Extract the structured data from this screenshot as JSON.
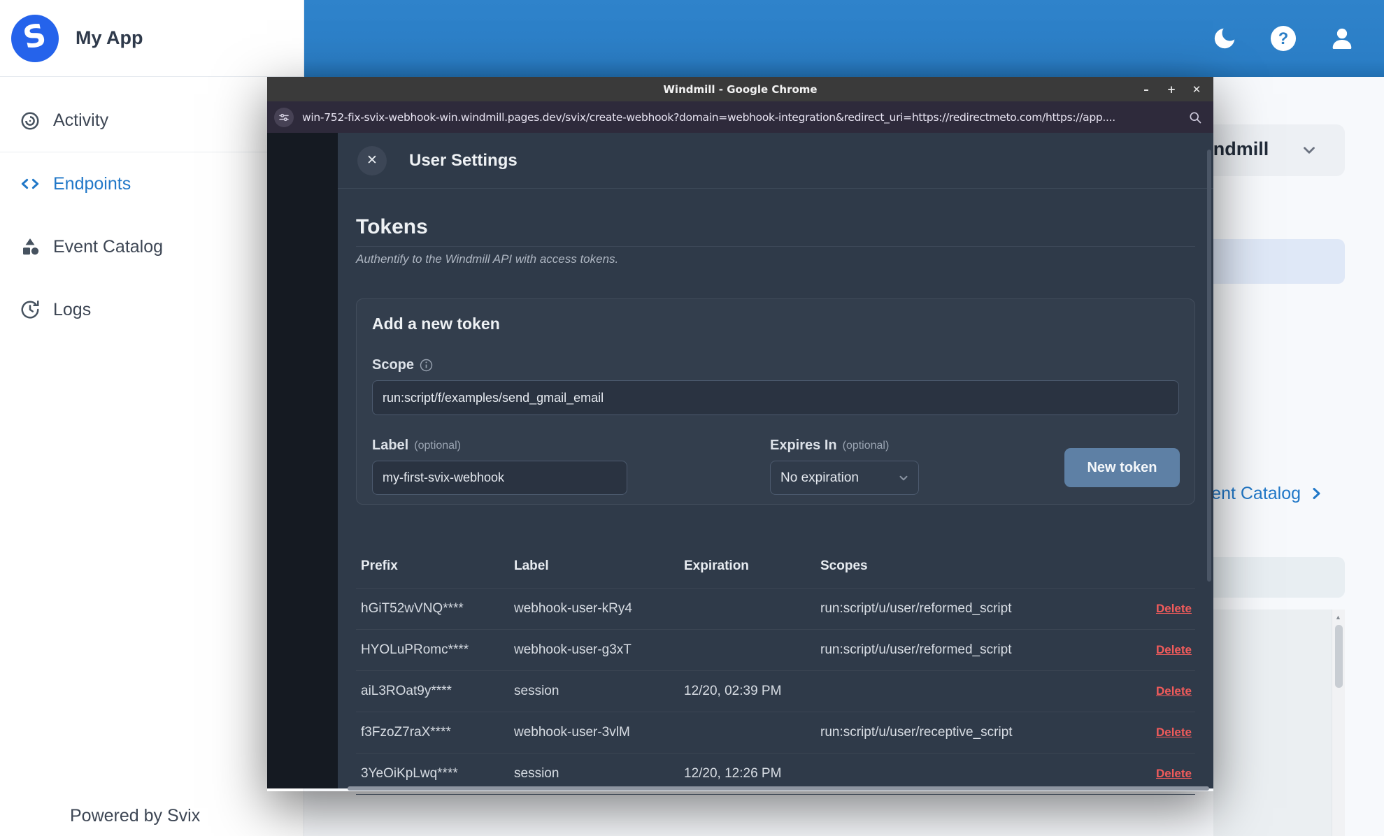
{
  "sidebar": {
    "app_name": "My App",
    "items": [
      {
        "label": "Activity"
      },
      {
        "label": "Endpoints"
      },
      {
        "label": "Event Catalog"
      },
      {
        "label": "Logs"
      }
    ],
    "footer": "Powered by Svix"
  },
  "background": {
    "workspace_selector_label": "Windmill",
    "event_catalog_link": "Event Catalog"
  },
  "window": {
    "title": "Windmill - Google Chrome",
    "controls": {
      "minimize": "–",
      "maximize": "+",
      "close": "✕"
    },
    "url": "win-752-fix-svix-webhook-win.windmill.pages.dev/svix/create-webhook?domain=webhook-integration&redirect_uri=https://redirectmeto.com/https://app....",
    "modal": {
      "title": "User Settings",
      "close_glyph": "✕",
      "tokens_heading": "Tokens",
      "tokens_subtitle": "Authentify to the Windmill API with access tokens.",
      "form": {
        "heading": "Add a new token",
        "scope_label": "Scope",
        "scope_value": "run:script/f/examples/send_gmail_email",
        "label_label": "Label",
        "optional_suffix": "(optional)",
        "label_value": "my-first-svix-webhook",
        "expires_label": "Expires In",
        "expires_value": "No expiration",
        "submit_label": "New token"
      },
      "table": {
        "headers": {
          "prefix": "Prefix",
          "label": "Label",
          "expiration": "Expiration",
          "scopes": "Scopes"
        },
        "delete_label": "Delete",
        "rows": [
          {
            "prefix": "hGiT52wVNQ****",
            "label": "webhook-user-kRy4",
            "expiration": "",
            "scopes": "run:script/u/user/reformed_script"
          },
          {
            "prefix": "HYOLuPRomc****",
            "label": "webhook-user-g3xT",
            "expiration": "",
            "scopes": "run:script/u/user/reformed_script"
          },
          {
            "prefix": "aiL3ROat9y****",
            "label": "session",
            "expiration": "12/20, 02:39 PM",
            "scopes": ""
          },
          {
            "prefix": "f3FzoZ7raX****",
            "label": "webhook-user-3vlM",
            "expiration": "",
            "scopes": "run:script/u/user/receptive_script"
          },
          {
            "prefix": "3YeOiKpLwq****",
            "label": "session",
            "expiration": "12/20, 12:26 PM",
            "scopes": ""
          }
        ]
      }
    }
  },
  "scrollbar": {
    "up_arrow": "▲"
  },
  "colors": {
    "topbar_blue": "#2b7fc7",
    "accent_blue": "#2178c8",
    "logo_blue": "#2563eb",
    "button_blue": "#5e80a5",
    "delete_red": "#f15b5b",
    "modal_bg": "#2f3a49"
  }
}
